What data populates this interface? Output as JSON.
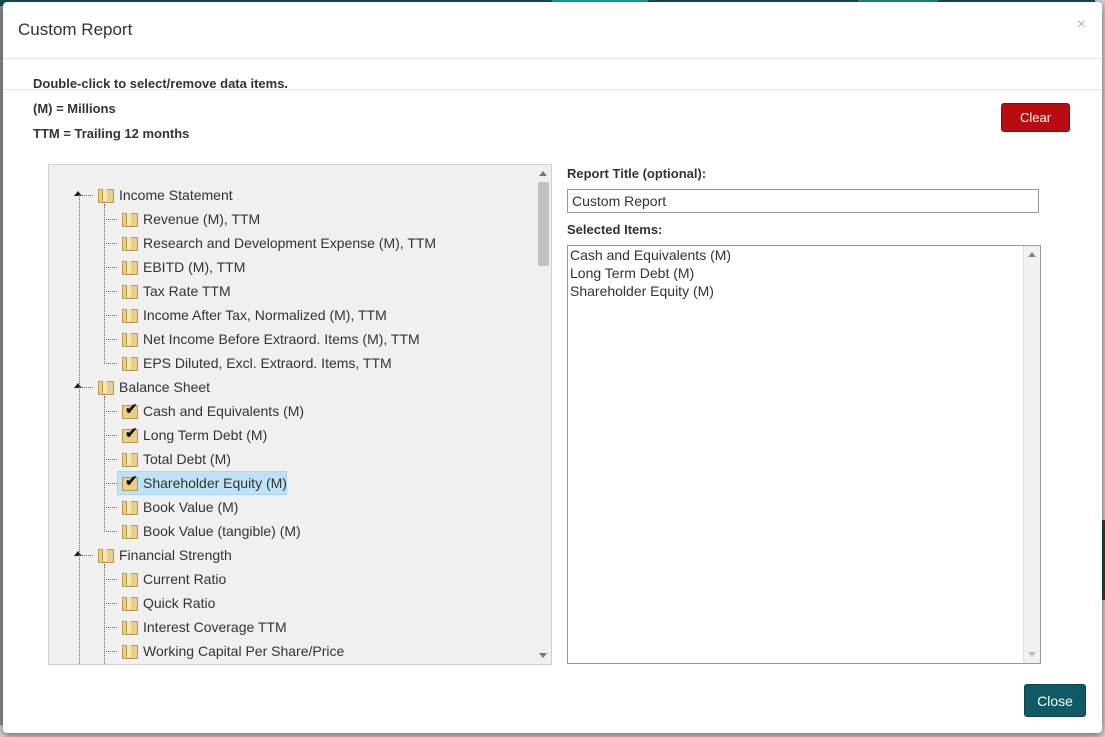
{
  "modal": {
    "title": "Custom Report",
    "close_symbol": "×"
  },
  "info": {
    "line1": "Double-click to select/remove data items.",
    "line2": "(M) = Millions",
    "line3": "TTM = Trailing 12 months"
  },
  "buttons": {
    "clear_label": "Clear",
    "close_label": "Close"
  },
  "colors": {
    "clear_button": "#b80d10",
    "close_button": "#0f5a63",
    "selection_highlight": "#bfe3f6"
  },
  "tree": {
    "groups": [
      {
        "label": "Income Statement",
        "icon": "folder-icon",
        "items": [
          {
            "label": "Revenue (M), TTM",
            "checked": false
          },
          {
            "label": "Research and Development Expense (M), TTM",
            "checked": false
          },
          {
            "label": "EBITD (M), TTM",
            "checked": false
          },
          {
            "label": "Tax Rate TTM",
            "checked": false
          },
          {
            "label": "Income After Tax, Normalized (M), TTM",
            "checked": false
          },
          {
            "label": "Net Income Before Extraord. Items (M), TTM",
            "checked": false
          },
          {
            "label": "EPS Diluted, Excl. Extraord. Items, TTM",
            "checked": false
          }
        ]
      },
      {
        "label": "Balance Sheet",
        "icon": "folder-icon",
        "items": [
          {
            "label": "Cash and Equivalents (M)",
            "checked": true
          },
          {
            "label": "Long Term Debt (M)",
            "checked": true
          },
          {
            "label": "Total Debt (M)",
            "checked": false
          },
          {
            "label": "Shareholder Equity (M)",
            "checked": true,
            "highlighted": true
          },
          {
            "label": "Book Value (M)",
            "checked": false
          },
          {
            "label": "Book Value (tangible) (M)",
            "checked": false
          }
        ]
      },
      {
        "label": "Financial Strength",
        "icon": "folder-icon",
        "items": [
          {
            "label": "Current Ratio",
            "checked": false
          },
          {
            "label": "Quick Ratio",
            "checked": false
          },
          {
            "label": "Interest Coverage TTM",
            "checked": false
          },
          {
            "label": "Working Capital Per Share/Price",
            "checked": false
          }
        ]
      }
    ]
  },
  "form": {
    "report_title_label": "Report Title (optional):",
    "report_title_value": "Custom Report",
    "selected_items_label": "Selected Items:",
    "selected_items": [
      "Cash and Equivalents (M)",
      "Long Term Debt (M)",
      "Shareholder Equity (M)"
    ]
  }
}
